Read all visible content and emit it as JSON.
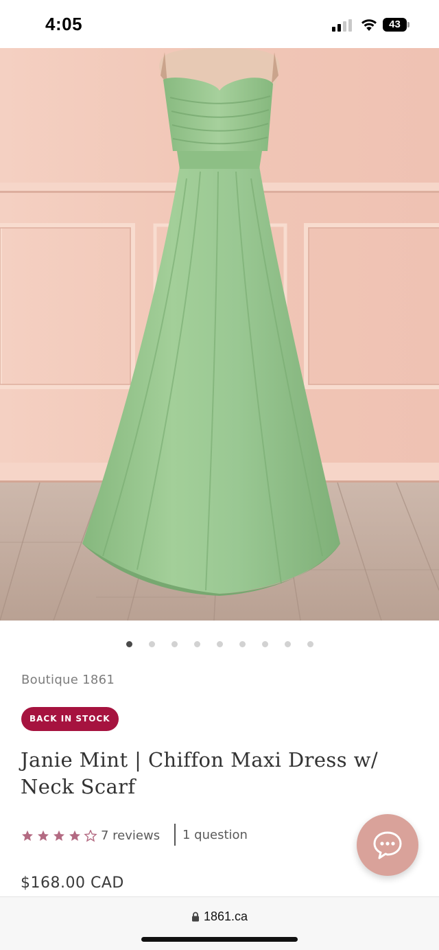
{
  "status_bar": {
    "time": "4:05",
    "battery_level": "43"
  },
  "product": {
    "image_alt": "Mint green strapless chiffon maxi dress on mannequin",
    "carousel_total": 9,
    "carousel_active": 1,
    "brand": "Boutique 1861",
    "badge": "BACK IN STOCK",
    "title": "Janie Mint | Chiffon Maxi Dress w/ Neck Scarf",
    "rating_value": 4.5,
    "rating_max": 5,
    "reviews_label": "7 reviews",
    "question_label": "1 question",
    "price": "$168.00 CAD"
  },
  "browser": {
    "url": "1861.ca"
  },
  "colors": {
    "badge": "#a6133f",
    "star": "#b36a82",
    "chat_button": "#d9a29a",
    "dress": "#9bc892",
    "wall": "#f2cbbd"
  },
  "icons": {
    "chat": "chat-bubble-icon",
    "lock": "lock-icon",
    "star": "star-icon"
  }
}
